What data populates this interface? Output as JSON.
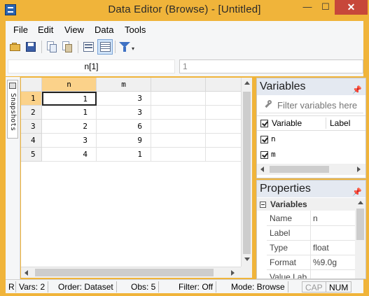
{
  "window": {
    "title": "Data Editor (Browse) - [Untitled]",
    "minimize_glyph": "—",
    "maximize_glyph": "☐",
    "close_glyph": "✕"
  },
  "menu": [
    "File",
    "Edit",
    "View",
    "Data",
    "Tools"
  ],
  "toolbar": {
    "icons": [
      "open-icon",
      "save-icon",
      "copy-icon",
      "paste-icon",
      "data-editor-edit-icon",
      "data-editor-browse-icon",
      "filter-icon",
      "dropdown-arrow-icon"
    ],
    "dropdown_glyph": "▾"
  },
  "cellbar": {
    "cell_name": "n[1]",
    "cell_value": "1"
  },
  "snapshots": {
    "label": "Snapshots"
  },
  "grid": {
    "columns": [
      "n",
      "m"
    ],
    "rows": [
      {
        "index": "1",
        "n": "1",
        "m": "3"
      },
      {
        "index": "2",
        "n": "1",
        "m": "3"
      },
      {
        "index": "3",
        "n": "2",
        "m": "6"
      },
      {
        "index": "4",
        "n": "3",
        "m": "9"
      },
      {
        "index": "5",
        "n": "4",
        "m": "1"
      }
    ]
  },
  "variables_panel": {
    "title": "Variables",
    "pin_glyph": "📌",
    "filter_placeholder": "Filter variables here",
    "header_variable": "Variable",
    "header_label": "Label",
    "items": [
      {
        "name": "n",
        "checked": true
      },
      {
        "name": "m",
        "checked": true
      }
    ]
  },
  "properties_panel": {
    "title": "Properties",
    "pin_glyph": "📌",
    "group": "Variables",
    "rows": [
      {
        "key": "Name",
        "value": "n"
      },
      {
        "key": "Label",
        "value": ""
      },
      {
        "key": "Type",
        "value": "float"
      },
      {
        "key": "Format",
        "value": "%9.0g"
      },
      {
        "key": "Value Lab",
        "value": ""
      }
    ]
  },
  "statusbar": {
    "ready": "R",
    "vars": "Vars: 2",
    "order": "Order: Dataset",
    "obs": "Obs: 5",
    "filter": "Filter: Off",
    "mode": "Mode: Browse",
    "cap": "CAP",
    "num": "NUM"
  }
}
